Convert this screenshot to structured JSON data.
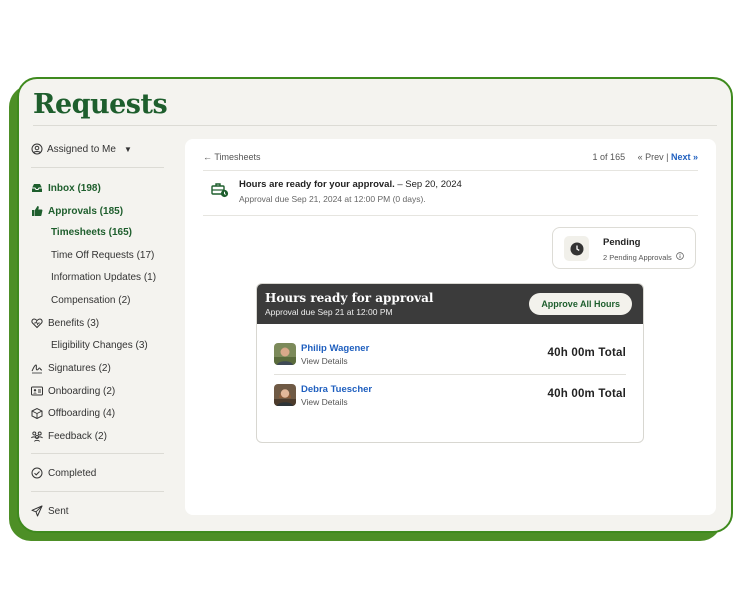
{
  "page": {
    "title": "Requests"
  },
  "sidebar": {
    "filter_label": "Assigned to Me",
    "items": [
      {
        "label": "Inbox (198)",
        "icon": "inbox-icon",
        "active": true
      },
      {
        "label": "Approvals (185)",
        "icon": "thumbs-up-icon",
        "active": true
      },
      {
        "label": "Timesheets (165)",
        "icon": "",
        "active": true
      },
      {
        "label": "Time Off Requests (17)",
        "icon": ""
      },
      {
        "label": "Information Updates (1)",
        "icon": ""
      },
      {
        "label": "Compensation (2)",
        "icon": ""
      },
      {
        "label": "Benefits (3)",
        "icon": "heart-icon"
      },
      {
        "label": "Eligibility Changes (3)",
        "icon": ""
      },
      {
        "label": "Signatures (2)",
        "icon": "signature-icon"
      },
      {
        "label": "Onboarding (2)",
        "icon": "id-card-icon"
      },
      {
        "label": "Offboarding (4)",
        "icon": "box-icon"
      },
      {
        "label": "Feedback (2)",
        "icon": "people-icon"
      },
      {
        "label": "Completed",
        "icon": "check-circle-icon"
      },
      {
        "label": "Sent",
        "icon": "send-icon"
      }
    ]
  },
  "main": {
    "breadcrumb": "← Timesheets",
    "pager": {
      "count": "1 of 165",
      "prev": "« Prev",
      "sep": "|",
      "next": "Next »"
    },
    "notice": {
      "title": "Hours are ready for your approval.",
      "date": " – Sep 20, 2024",
      "due": "Approval due Sep 21, 2024 at 12:00 PM (0 days)."
    },
    "status": {
      "title": "Pending",
      "subtitle": "2 Pending Approvals"
    },
    "card": {
      "title": "Hours ready for approval",
      "subtitle": "Approval due Sep 21 at 12:00 PM",
      "approve_label": "Approve All Hours",
      "rows": [
        {
          "name": "Philip Wagener",
          "link": "View Details",
          "total": "40h 00m Total"
        },
        {
          "name": "Debra Tuescher",
          "link": "View Details",
          "total": "40h 00m Total"
        }
      ]
    }
  },
  "colors": {
    "brand_green": "#1e5e2d",
    "frame_green": "#4d8f26",
    "link_blue": "#1f5fbf",
    "header_dark": "#3b3b3b"
  }
}
